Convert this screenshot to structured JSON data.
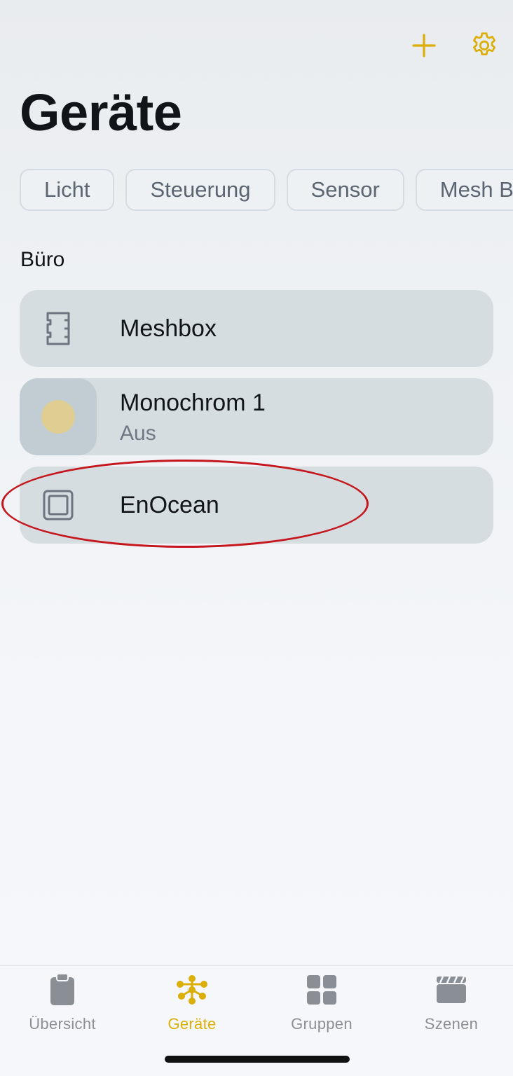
{
  "colors": {
    "accent": "#dcae08",
    "annotation": "#c4161c"
  },
  "header": {
    "title": "Geräte",
    "add_icon": "plus-icon",
    "settings_icon": "gear-icon"
  },
  "filters": [
    {
      "label": "Licht"
    },
    {
      "label": "Steuerung"
    },
    {
      "label": "Sensor"
    },
    {
      "label": "Mesh Box"
    }
  ],
  "section": {
    "title": "Büro"
  },
  "devices": [
    {
      "name": "Meshbox",
      "icon": "meshbox-icon"
    },
    {
      "name": "Monochrom 1",
      "status": "Aus",
      "icon": "lamp-indicator"
    },
    {
      "name": "EnOcean",
      "icon": "enocean-switch-icon"
    }
  ],
  "tabs": [
    {
      "label": "Übersicht",
      "icon": "clipboard-icon"
    },
    {
      "label": "Geräte",
      "icon": "network-icon",
      "active": true
    },
    {
      "label": "Gruppen",
      "icon": "grid-icon"
    },
    {
      "label": "Szenen",
      "icon": "clapperboard-icon"
    }
  ]
}
